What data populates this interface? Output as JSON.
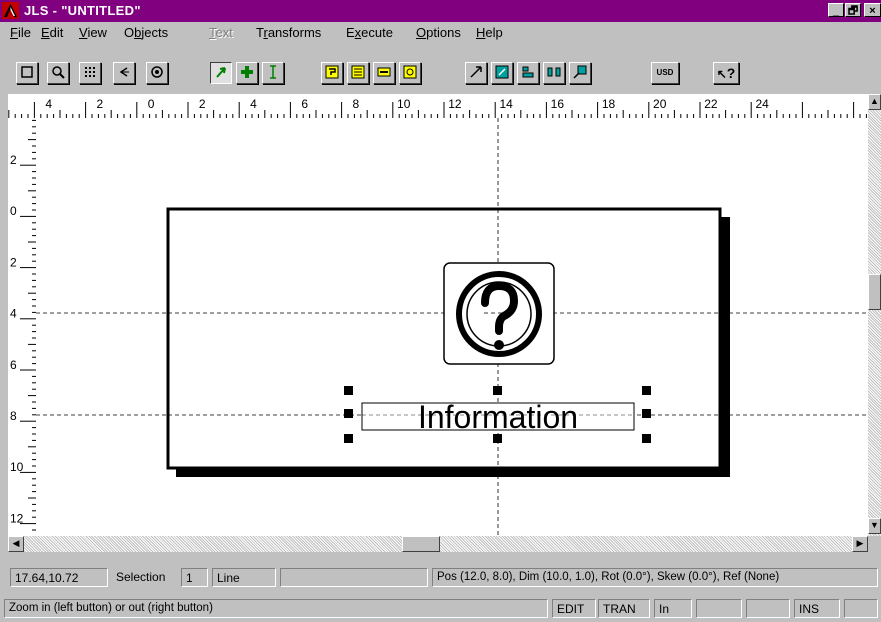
{
  "window": {
    "title": "JLS - \"UNTITLED\"",
    "controls": {
      "minimize": "_",
      "maximize": "🗗",
      "close": "×"
    }
  },
  "menu": [
    "File",
    "Edit",
    "View",
    "Objects",
    "Text",
    "Transforms",
    "Execute",
    "Options",
    "Help"
  ],
  "menu_underline": [
    "F",
    "E",
    "V",
    "b",
    "T",
    "r",
    "x",
    "O",
    "H"
  ],
  "toolbar": {
    "usd_label": "USD",
    "help_label": "?"
  },
  "ruler": {
    "top_labels": [
      "4",
      "2",
      "0",
      "2",
      "4",
      "6",
      "8",
      "10",
      "12",
      "14",
      "16",
      "18",
      "20",
      "22",
      "24"
    ],
    "left_labels": [
      "2",
      "0",
      "2",
      "4",
      "6",
      "8",
      "10",
      "12"
    ]
  },
  "canvas": {
    "label_text": "Information",
    "symbol": "question-mark"
  },
  "status": {
    "coords": "17.64,10.72",
    "selection_label": "Selection",
    "selection_count": "1",
    "object_type": "Line",
    "blank1": "",
    "transform_info": "Pos (12.0, 8.0), Dim (10.0, 1.0), Rot (0.0°), Skew (0.0°), Ref (None)",
    "hint": "Zoom in (left button) or out (right button)",
    "mode_edit": "EDIT",
    "mode_tran": "TRAN",
    "units": "In",
    "ins": "INS"
  },
  "colors": {
    "titlebar": "#800080",
    "face": "#c0c0c0",
    "toolbar_highlight": "#ffff00",
    "arrow_green": "#008000"
  }
}
